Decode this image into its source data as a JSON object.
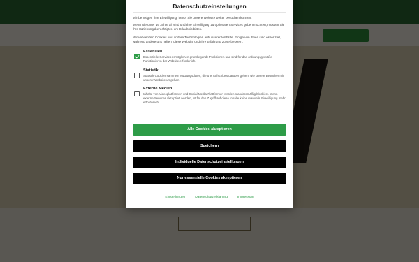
{
  "dialog": {
    "title": "Datenschutzeinstellungen",
    "intro_1": "Wir benötigen Ihre Einwilligung, bevor Sie unsere Website weiter besuchen können.",
    "intro_2": "Wenn Sie unter 16 Jahre alt sind und Ihre Einwilligung zu optionalen Services geben möchten, müssen Sie Ihre Erziehungsberechtigten um Erlaubnis bitten.",
    "intro_3": "Wir verwenden Cookies und andere Technologien auf unserer Website. Einige von ihnen sind essenziell, während andere uns helfen, diese Website und Ihre Erfahrung zu verbessern.",
    "categories": [
      {
        "label": "Essenziell",
        "description": "Essenzielle Services ermöglichen grundlegende Funktionen und sind für das ordnungsgemäße Funktionieren der Website erforderlich.",
        "checked": true
      },
      {
        "label": "Statistik",
        "description": "Statistik Cookies sammeln Nutzungsdaten, die uns Aufschluss darüber geben, wie unsere Besucher mit unserer Website umgehen.",
        "checked": false
      },
      {
        "label": "Externe Medien",
        "description": "Inhalte von Videoplattformen und Social-Media-Plattformen werden standardmäßig blockiert. Wenn externe Services akzeptiert werden, ist für den Zugriff auf diese Inhalte keine manuelle Einwilligung mehr erforderlich.",
        "checked": false
      }
    ],
    "buttons": {
      "accept_all": "Alle Cookies akzeptieren",
      "save": "Speichern",
      "individual": "Individuelle Datenschutzeinstellungen",
      "essential_only": "Nur essenzielle Cookies akzeptieren"
    },
    "footer_links": [
      "Einstellungen",
      "Datenschutzerklärung",
      "Impressum"
    ]
  },
  "colors": {
    "accent": "#2e9c48",
    "button_dark": "#000000",
    "overlay": "rgba(0,0,0,0.62)"
  }
}
